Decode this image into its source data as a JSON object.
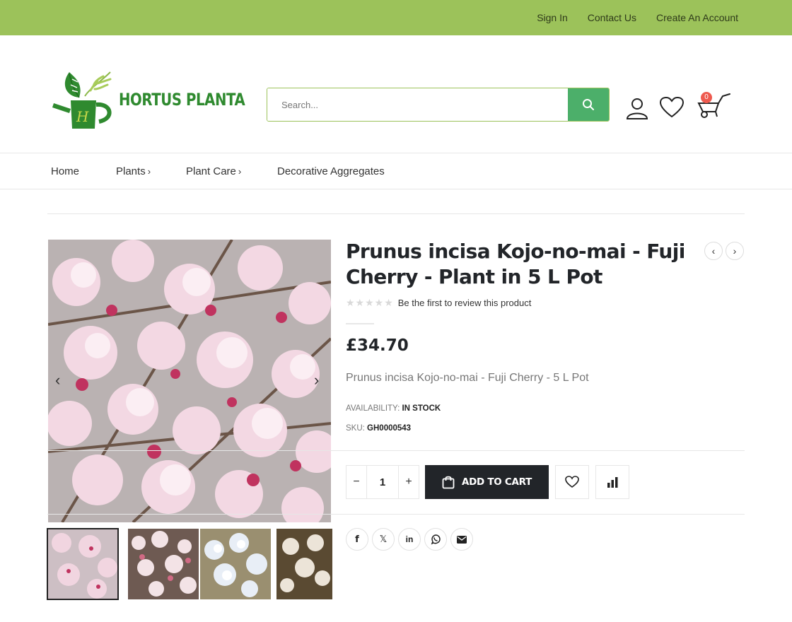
{
  "topbar": {
    "links": [
      "Sign In",
      "Contact Us",
      "Create An Account"
    ]
  },
  "header": {
    "logo_text": "HORTUS PLANTA",
    "search": {
      "placeholder": "Search..."
    },
    "cart_count": "0"
  },
  "nav": {
    "items": [
      {
        "label": "Home",
        "has_submenu": false
      },
      {
        "label": "Plants",
        "has_submenu": true
      },
      {
        "label": "Plant Care",
        "has_submenu": true
      },
      {
        "label": "Decorative Aggregates",
        "has_submenu": false
      }
    ]
  },
  "product": {
    "title": "Prunus incisa Kojo-no-mai - Fuji Cherry - Plant in 5 L Pot",
    "rating": {
      "stars": 0,
      "max": 5,
      "review_text": "Be the first to review this product"
    },
    "price": "£34.70",
    "short_description": "Prunus incisa Kojo-no-mai - Fuji Cherry - 5 L Pot",
    "availability_label": "AVAILABILITY:",
    "availability_value": "IN STOCK",
    "sku_label": "SKU:",
    "sku_value": "GH0000543",
    "quantity": "1",
    "add_to_cart_label": "ADD TO CART",
    "thumbnails": [
      "pink-blossom",
      "pink-white-blossom",
      "white-blossom",
      "white-blossom-shrub"
    ]
  },
  "social": [
    "facebook-icon",
    "x-icon",
    "linkedin-icon",
    "whatsapp-icon",
    "email-icon"
  ],
  "colors": {
    "topbar": "#9cc25a",
    "search_button": "#4caf6a",
    "logo_green": "#2f8a2f",
    "cart_button": "#222529",
    "badge": "#ee5a4f"
  }
}
